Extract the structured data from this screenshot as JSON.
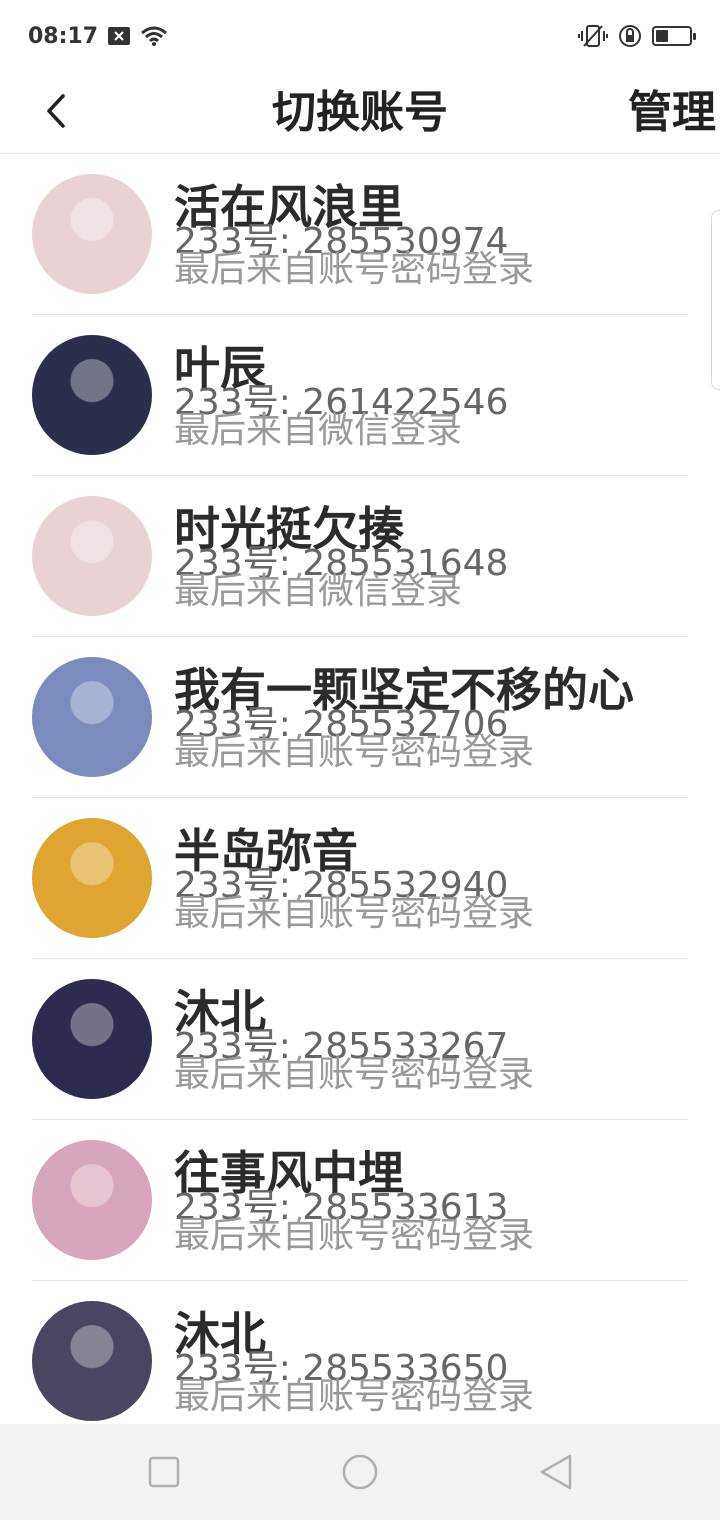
{
  "status_bar": {
    "time": "08:17",
    "left_icons": [
      "close-box-icon",
      "wifi-icon"
    ],
    "right_icons": [
      "vibrate-icon",
      "rotation-lock-icon",
      "battery-icon"
    ],
    "battery_level": 0.45
  },
  "header": {
    "title": "切换账号",
    "manage_label": "管理"
  },
  "accounts": [
    {
      "name": "活在风浪里",
      "id": "233号: 285530974",
      "source": "最后来自账号密码登录",
      "avatar_color": "#e8d2d4"
    },
    {
      "name": "叶辰",
      "id": "233号: 261422546",
      "source": "最后来自微信登录",
      "avatar_color": "#2c2f4c"
    },
    {
      "name": "时光挺欠揍",
      "id": "233号: 285531648",
      "source": "最后来自微信登录",
      "avatar_color": "#e8d2d4"
    },
    {
      "name": "我有一颗坚定不移的心",
      "id": "233号: 285532706",
      "source": "最后来自账号密码登录",
      "avatar_color": "#7c8bbd"
    },
    {
      "name": "半岛弥音",
      "id": "233号: 285532940",
      "source": "最后来自账号密码登录",
      "avatar_color": "#e0a530"
    },
    {
      "name": "沐北",
      "id": "233号: 285533267",
      "source": "最后来自账号密码登录",
      "avatar_color": "#2d2c4e"
    },
    {
      "name": "往事风中埋",
      "id": "233号: 285533613",
      "source": "最后来自账号密码登录",
      "avatar_color": "#d8a6bc"
    },
    {
      "name": "沐北",
      "id": "233号: 285533650",
      "source": "最后来自账号密码登录",
      "avatar_color": "#4a4560"
    }
  ],
  "nav_bar": {
    "buttons": [
      "recents-square-icon",
      "home-circle-icon",
      "back-triangle-icon"
    ]
  }
}
